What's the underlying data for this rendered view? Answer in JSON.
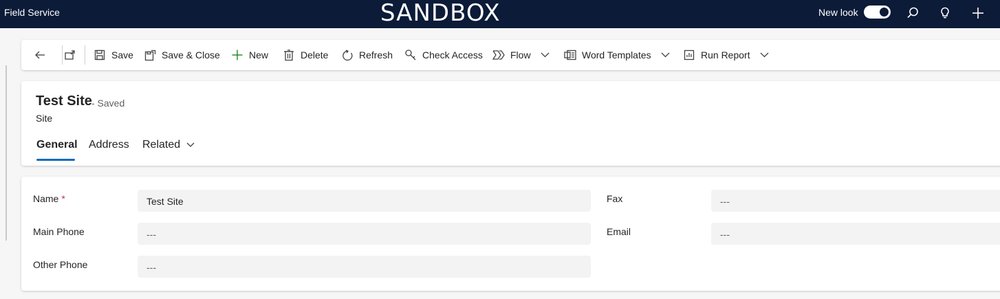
{
  "topbar": {
    "app_title": "Field Service",
    "environment": "SANDBOX",
    "new_look_label": "New look",
    "new_look_enabled": true
  },
  "commands": {
    "save": "Save",
    "save_close": "Save & Close",
    "new": "New",
    "delete": "Delete",
    "refresh": "Refresh",
    "check_access": "Check Access",
    "flow": "Flow",
    "word_templates": "Word Templates",
    "run_report": "Run Report"
  },
  "record": {
    "title": "Test Site",
    "status": "- Saved",
    "entity": "Site"
  },
  "tabs": [
    {
      "label": "General",
      "active": true
    },
    {
      "label": "Address",
      "active": false
    },
    {
      "label": "Related",
      "active": false
    }
  ],
  "form": {
    "name": {
      "label": "Name",
      "required_mark": "*",
      "value": "Test Site"
    },
    "main_phone": {
      "label": "Main Phone",
      "value": "---"
    },
    "other_phone": {
      "label": "Other Phone",
      "value": "---"
    },
    "fax": {
      "label": "Fax",
      "value": "---"
    },
    "email": {
      "label": "Email",
      "value": "---"
    }
  },
  "colors": {
    "topbar_bg": "#0b1b38",
    "accent": "#0f6cbd",
    "new_icon": "#107c10",
    "required": "#c4314b"
  }
}
